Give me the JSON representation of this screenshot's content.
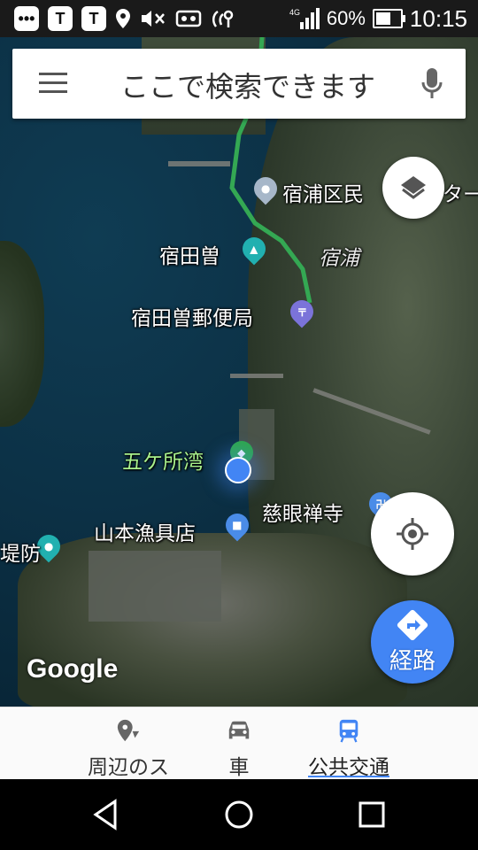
{
  "status_bar": {
    "app_icons": [
      "T",
      "T"
    ],
    "battery_percent": 60,
    "battery_text": "60%",
    "network": "4G",
    "time": "10:15"
  },
  "search": {
    "placeholder": "ここで検索できます"
  },
  "map": {
    "labels": {
      "shukuura_minshuku": "宿浦区民",
      "shukuura_minshuku_tail": "ター",
      "shukutaso": "宿田曽",
      "shukuura": "宿浦",
      "post_office": "宿田曽郵便局",
      "gokasho_bay": "五ケ所湾",
      "jigenzenji": "慈眼禅寺",
      "yamamoto_gyogu": "山本漁具店",
      "breakwater": "堤防"
    },
    "colors": {
      "route": "#34a853",
      "accent": "#4285f4",
      "pin_teal": "#21b0b0",
      "pin_purple": "#7b73d9",
      "pin_blue": "#4a8ce8",
      "pin_green": "#2ea84a"
    }
  },
  "controls": {
    "layers_icon": "layers-icon",
    "locate_icon": "my-location-icon",
    "route_label": "経路"
  },
  "attribution": "Google",
  "tabs": [
    {
      "label": "周辺のス",
      "icon": "place-pin-icon"
    },
    {
      "label": "車",
      "icon": "car-icon"
    },
    {
      "label": "公共交通",
      "icon": "transit-icon",
      "active": true
    }
  ]
}
